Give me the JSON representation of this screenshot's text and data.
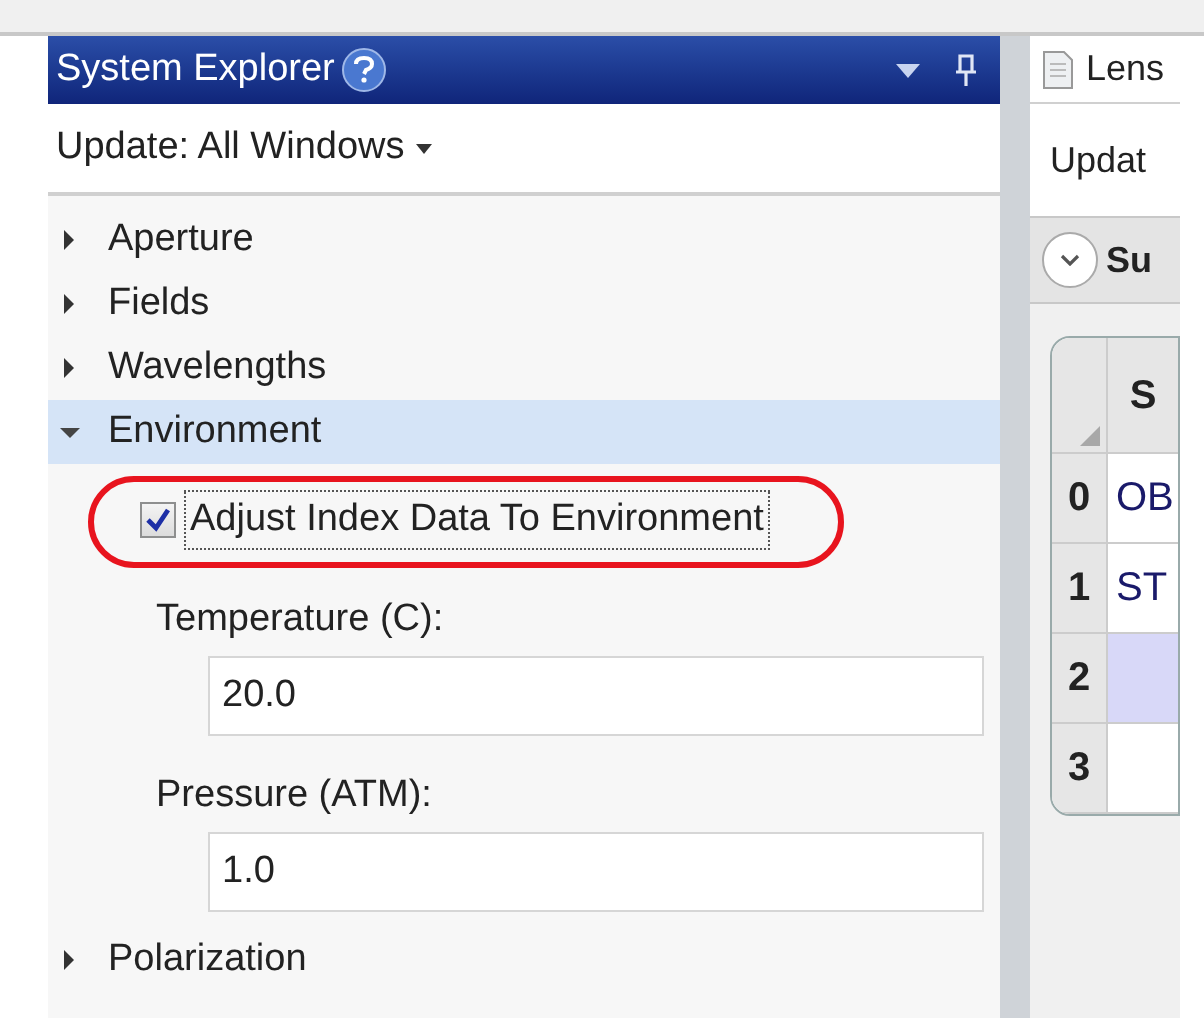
{
  "panel": {
    "title": "System Explorer",
    "update_menu": "Update: All Windows"
  },
  "tree": [
    {
      "label": "Aperture",
      "expanded": false,
      "selected": false
    },
    {
      "label": "Fields",
      "expanded": false,
      "selected": false
    },
    {
      "label": "Wavelengths",
      "expanded": false,
      "selected": false
    },
    {
      "label": "Environment",
      "expanded": true,
      "selected": true,
      "children": [
        {
          "kind": "checkbox",
          "label": "Adjust Index Data To Environment",
          "checked": true,
          "highlighted": true
        },
        {
          "kind": "field",
          "label": "Temperature (C):",
          "value": "20.0"
        },
        {
          "kind": "field",
          "label": "Pressure (ATM):",
          "value": "1.0"
        }
      ]
    },
    {
      "label": "Polarization",
      "expanded": false,
      "selected": false
    }
  ],
  "editor": {
    "tab": "Lens",
    "toolbar": "Updat",
    "section": "Su",
    "column_1": "S",
    "rows": [
      {
        "number": "0",
        "cell": "OB",
        "selected": false
      },
      {
        "number": "1",
        "cell": "ST",
        "selected": false
      },
      {
        "number": "2",
        "cell": "",
        "selected": true
      },
      {
        "number": "3",
        "cell": "",
        "selected": false
      }
    ]
  }
}
